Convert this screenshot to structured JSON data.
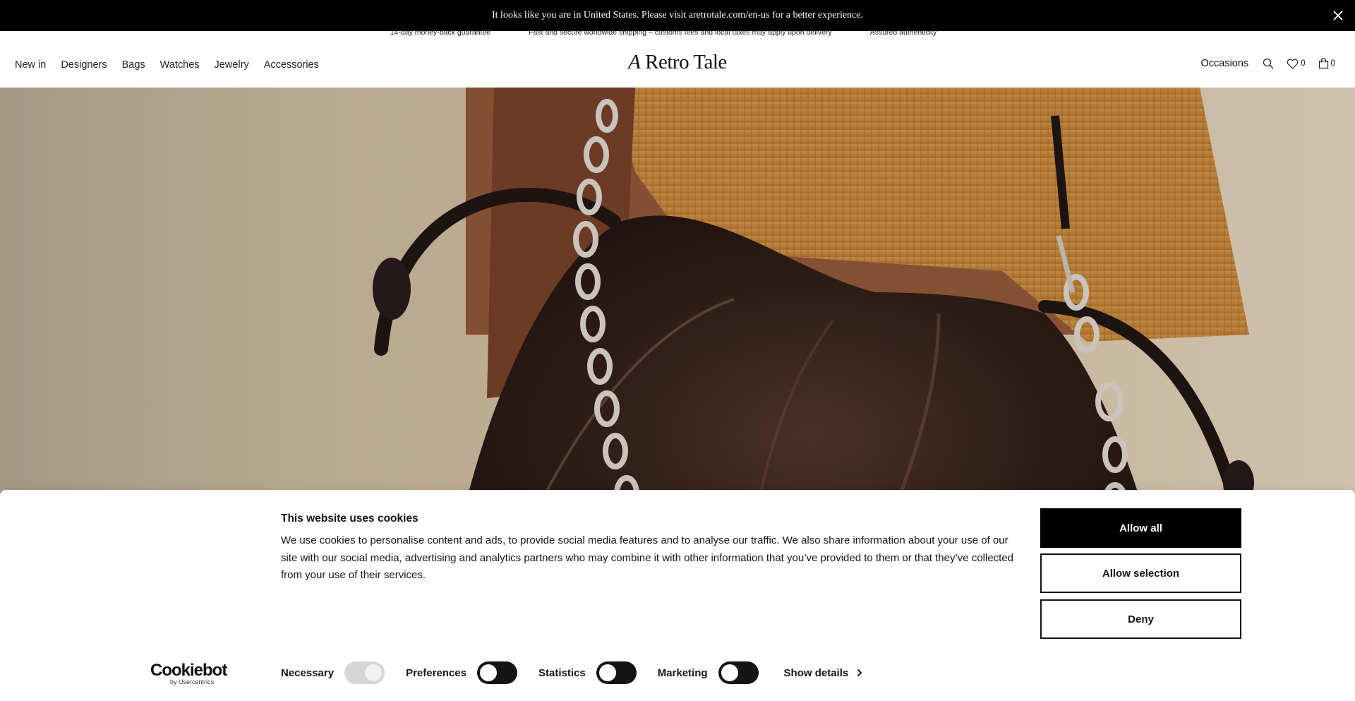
{
  "geo_banner": {
    "message": "It looks like you are in United States. Please visit aretrotale.com/en-us for a better experience.",
    "close_icon": "close-icon"
  },
  "usp": [
    "14-day money-back guarantee",
    "Fast and secure worldwide shipping – customs fees and local taxes may apply upon delivery",
    "Assured authenticity"
  ],
  "header": {
    "nav": [
      "New in",
      "Designers",
      "Bags",
      "Watches",
      "Jewelry",
      "Accessories"
    ],
    "logo_a": "A",
    "logo_rest": "Retro Tale",
    "occasions": "Occasions",
    "wishlist_count": "0",
    "cart_count": "0"
  },
  "cookie": {
    "title": "This website uses cookies",
    "text": "We use cookies to personalise content and ads, to provide social media features and to analyse our traffic. We also share information about your use of our site with our social media, advertising and analytics partners who may combine it with other information that you’ve provided to them or that they’ve collected from your use of their services.",
    "allow_all": "Allow all",
    "allow_selection": "Allow selection",
    "deny": "Deny",
    "brand": "Cookiebot",
    "brand_sub": "by Usercentrics",
    "categories": [
      {
        "label": "Necessary",
        "enabled": true,
        "locked": true
      },
      {
        "label": "Preferences",
        "enabled": false
      },
      {
        "label": "Statistics",
        "enabled": false
      },
      {
        "label": "Marketing",
        "enabled": false
      }
    ],
    "show_details": "Show details"
  },
  "colors": {
    "banner_bg": "#000000",
    "primary_button": "#000000",
    "toggle_off": "#141414",
    "toggle_locked": "#d6d6d6"
  }
}
